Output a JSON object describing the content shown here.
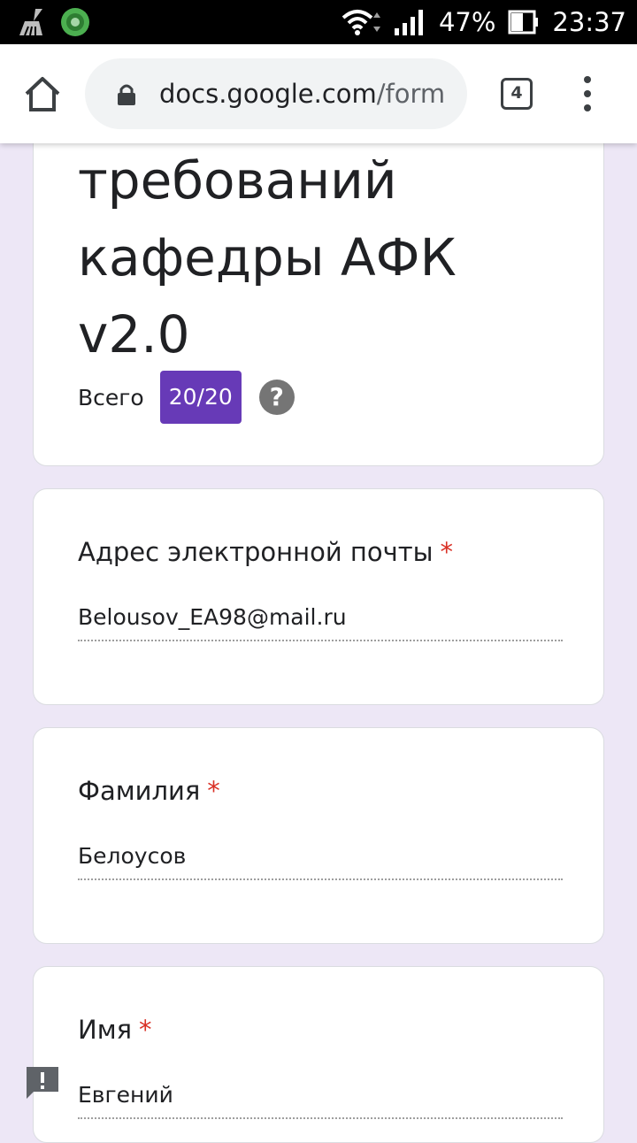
{
  "status_bar": {
    "battery_percent": "47%",
    "time": "23:37"
  },
  "browser": {
    "url_host": "docs.google.com",
    "url_path": "/form",
    "tab_count": "4"
  },
  "form": {
    "title": "требований\nкафедры АФК\nv2.0",
    "score_label": "Всего",
    "score_value": "20/20",
    "accent_color": "#673ab7",
    "questions": [
      {
        "label": "Адрес электронной почты",
        "required_mark": "*",
        "answer": "Belousov_EA98@mail.ru"
      },
      {
        "label": "Фамилия",
        "required_mark": "*",
        "answer": "Белоусов"
      },
      {
        "label": "Имя",
        "required_mark": "*",
        "answer": "Евгений"
      }
    ]
  }
}
